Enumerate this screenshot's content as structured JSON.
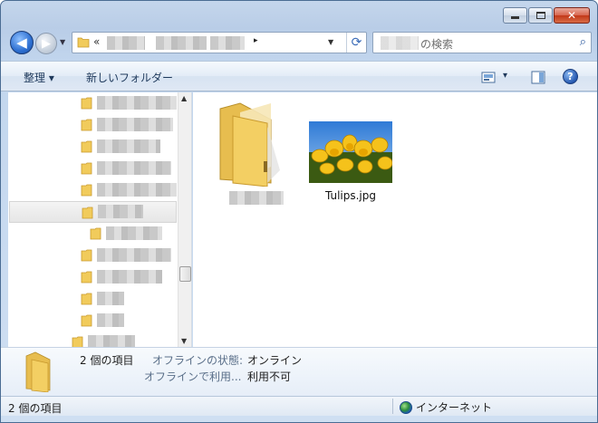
{
  "window": {
    "caption_buttons": [
      "minimize",
      "maximize",
      "close"
    ],
    "close_glyph": "✕"
  },
  "nav": {
    "back_glyph": "◀",
    "forward_glyph": "▶",
    "address_prefix": "«",
    "address_arrow": "▸",
    "refresh_glyph": "⟳",
    "search_placeholder": "の検索",
    "search_glyph": "⌕"
  },
  "toolbar": {
    "organize_label": "整理 ▾",
    "new_folder_label": "新しいフォルダー",
    "views_dropdown_glyph": "▾",
    "help_glyph": "?"
  },
  "nav_pane": {
    "tree_items": [
      {
        "indent": 0,
        "selected": false
      },
      {
        "indent": 0,
        "selected": false
      },
      {
        "indent": 0,
        "selected": false
      },
      {
        "indent": 0,
        "selected": false
      },
      {
        "indent": 0,
        "selected": false
      },
      {
        "indent": 0,
        "selected": true
      },
      {
        "indent": 1,
        "selected": false
      },
      {
        "indent": 0,
        "selected": false
      },
      {
        "indent": 0,
        "selected": false
      },
      {
        "indent": 0,
        "selected": false
      },
      {
        "indent": 0,
        "selected": false
      },
      {
        "indent": -1,
        "selected": false
      }
    ],
    "scroll_up_glyph": "▲",
    "scroll_down_glyph": "▼"
  },
  "content": {
    "items": [
      {
        "type": "folder",
        "label": ""
      },
      {
        "type": "image",
        "label": "Tulips.jpg"
      }
    ]
  },
  "details": {
    "count": "2 個の項目",
    "offline_status_key": "オフラインの状態:",
    "offline_status_value": "オンライン",
    "offline_avail_key": "オフラインで利用...",
    "offline_avail_value": "利用不可"
  },
  "status_bar": {
    "item_count": "2 個の項目",
    "zone": "インターネット"
  },
  "colors": {
    "folder": "#f3cf63",
    "folder_dark": "#d9ac3c",
    "accent": "#1e395b"
  }
}
